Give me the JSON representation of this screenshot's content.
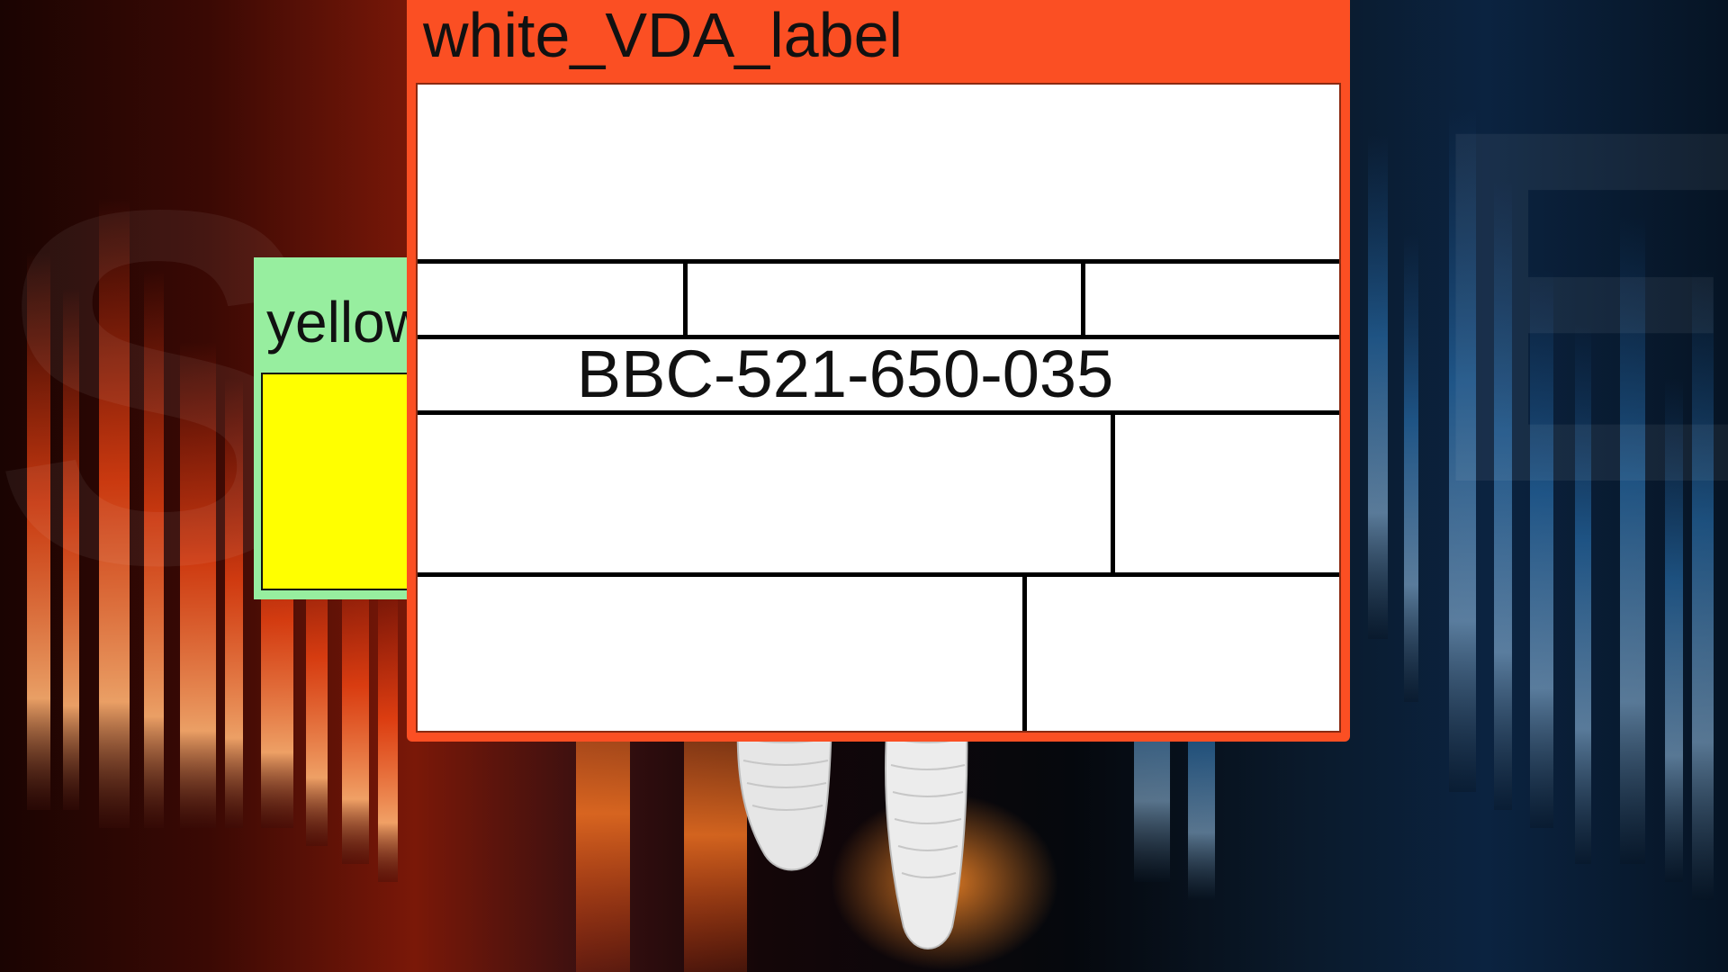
{
  "windows": {
    "main": {
      "title": "white_VDA_label",
      "header_color": "#fb4f23",
      "label": {
        "code": "BBC-521-650-035"
      }
    },
    "secondary": {
      "title": "yellow",
      "header_color": "#97ee9f",
      "content_color": "#ffff00"
    }
  },
  "icons": {
    "background": "astronaut-wallpaper"
  }
}
